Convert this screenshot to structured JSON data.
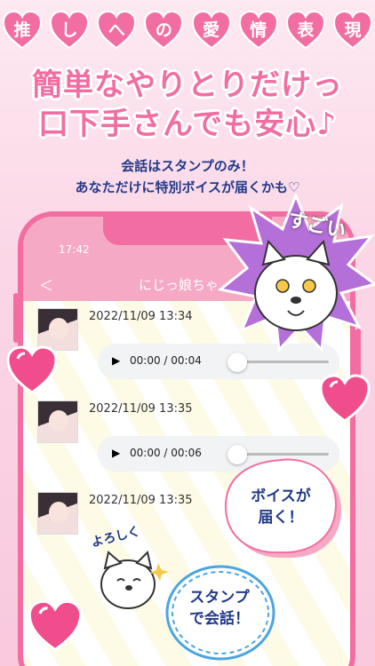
{
  "title_chars": [
    "推",
    "し",
    "へ",
    "の",
    "愛",
    "情",
    "表",
    "現"
  ],
  "headline": {
    "line1": "簡単なやりとりだけっ",
    "line2": "口下手さんでも安心♪"
  },
  "subtext": {
    "line1": "会話はスタンプのみ！",
    "line2": "あなただけに特別ボイスが届くかも♡"
  },
  "app": {
    "status_time": "17:42",
    "back_label": "＜",
    "chat_title": "にじっ娘ちゃ"
  },
  "messages": [
    {
      "timestamp": "2022/11/09 13:34",
      "audio_time": "00:00 / 00:04"
    },
    {
      "timestamp": "2022/11/09 13:35",
      "audio_time": "00:00 / 00:06"
    },
    {
      "timestamp": "2022/11/09 13:35",
      "audio_time": ""
    }
  ],
  "play_glyph": "▶",
  "badges": {
    "sugoi": "すごい",
    "voice_line1": "ボイスが",
    "voice_line2": "届く！",
    "stamp_line1": "スタンプ",
    "stamp_line2": "で会話！",
    "yoroshiku": "よろしく"
  },
  "colors": {
    "pink": "#f26ea2",
    "navy": "#233a88",
    "light_pink": "#f6a9c4"
  }
}
